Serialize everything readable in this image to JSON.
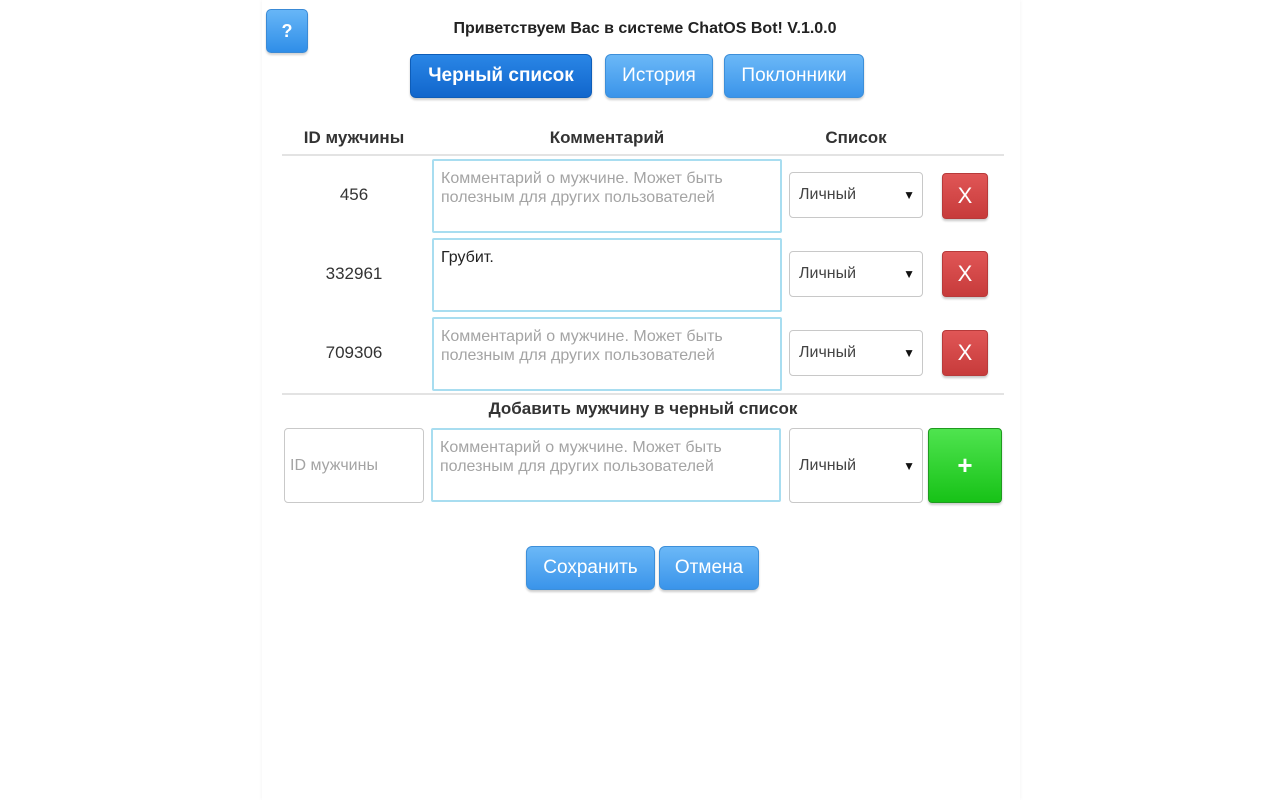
{
  "header": {
    "help_label": "?",
    "welcome": "Приветствуем Вас в системе ChatOS Bot! V.1.0.0"
  },
  "tabs": [
    {
      "label": "Черный список",
      "active": true
    },
    {
      "label": "История",
      "active": false
    },
    {
      "label": "Поклонники",
      "active": false
    }
  ],
  "table": {
    "headers": {
      "id": "ID мужчины",
      "comment": "Комментарий",
      "list": "Список"
    },
    "rows": [
      {
        "id": "456",
        "comment": "",
        "list": "Личный",
        "delete_label": "X"
      },
      {
        "id": "332961",
        "comment": "Грубит.",
        "list": "Личный",
        "delete_label": "X"
      },
      {
        "id": "709306",
        "comment": "",
        "list": "Личный",
        "delete_label": "X"
      }
    ],
    "comment_placeholder": "Комментарий о мужчине. Может быть полезным для других пользователей"
  },
  "add_form": {
    "title": "Добавить мужчину в черный список",
    "id_placeholder": "ID мужчины",
    "comment_placeholder": "Комментарий о мужчине. Может быть полезным для других пользователей",
    "list": "Личный",
    "add_label": "+"
  },
  "actions": {
    "save": "Сохранить",
    "cancel": "Отмена"
  },
  "icons": {
    "dropdown": "triangle-down-icon"
  },
  "colors": {
    "primary": "#3a94ea",
    "primary_active": "#1166cc",
    "danger": "#d04545",
    "success": "#22cc22",
    "input_border": "#a8ddf0"
  }
}
